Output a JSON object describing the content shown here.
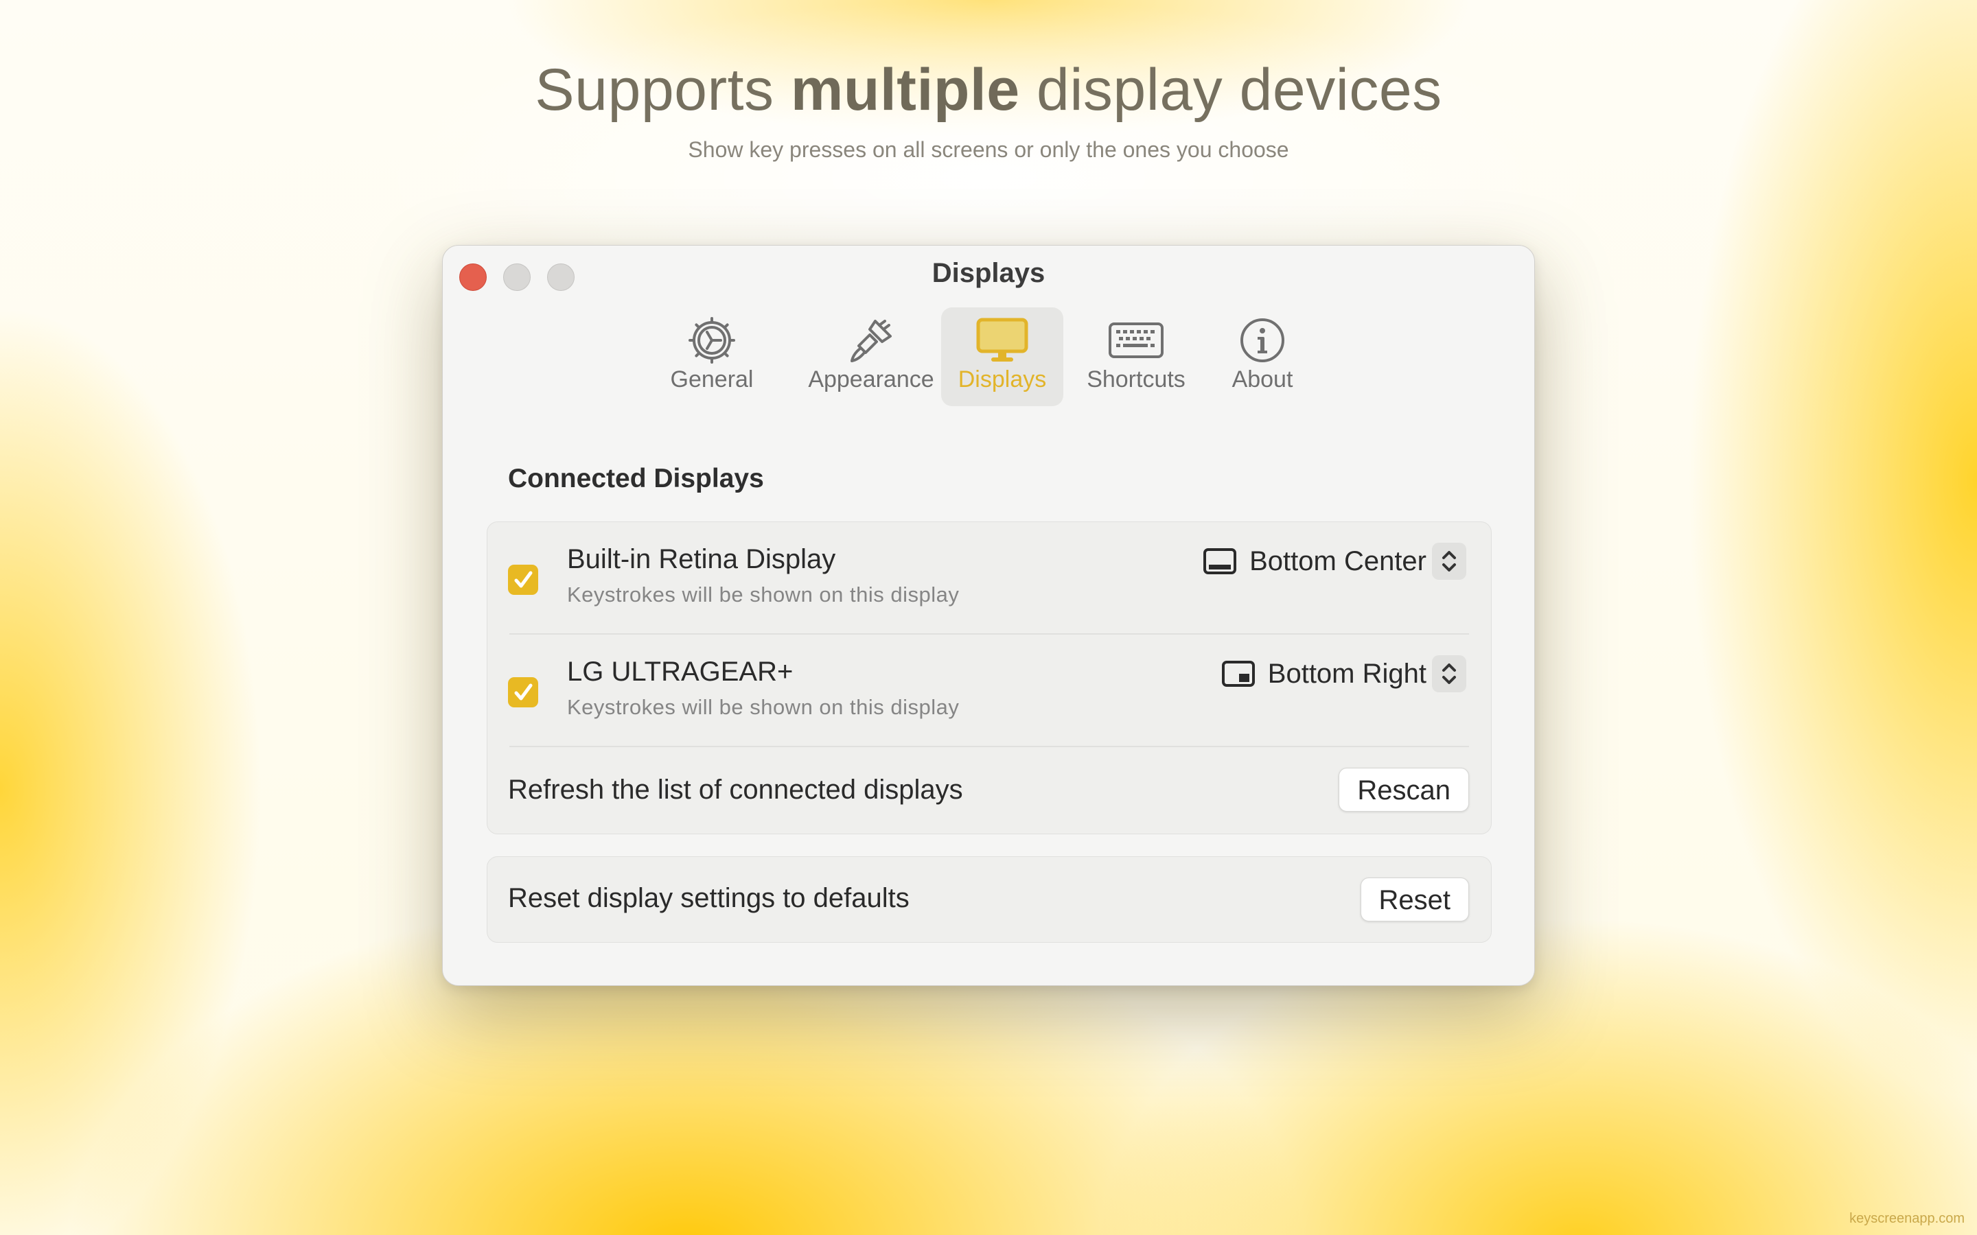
{
  "hero": {
    "title_before": "Supports ",
    "title_bold": "multiple",
    "title_after": " display devices",
    "subtitle": "Show key presses on all screens or only the ones you choose"
  },
  "watermark": "keyscreenapp.com",
  "window": {
    "title": "Displays",
    "tabs": [
      {
        "label": "General",
        "icon": "gear-icon"
      },
      {
        "label": "Appearance",
        "icon": "paintbrush-icon"
      },
      {
        "label": "Displays",
        "icon": "display-icon",
        "active": true
      },
      {
        "label": "Shortcuts",
        "icon": "keyboard-icon"
      },
      {
        "label": "About",
        "icon": "info-icon"
      }
    ],
    "accent_color": "#e8b923"
  },
  "connected": {
    "section_title": "Connected Displays",
    "displays": [
      {
        "name": "Built-in Retina Display",
        "subtitle": "Keystrokes will be shown on this display",
        "checked": true,
        "position": "Bottom Center",
        "position_icon": "bottom-center-position-icon"
      },
      {
        "name": "LG ULTRAGEAR+",
        "subtitle": "Keystrokes will be shown on this display",
        "checked": true,
        "position": "Bottom Right",
        "position_icon": "bottom-right-position-icon"
      }
    ],
    "refresh_label": "Refresh the list of connected displays",
    "rescan_button": "Rescan"
  },
  "reset": {
    "label": "Reset display settings to defaults",
    "button": "Reset"
  }
}
